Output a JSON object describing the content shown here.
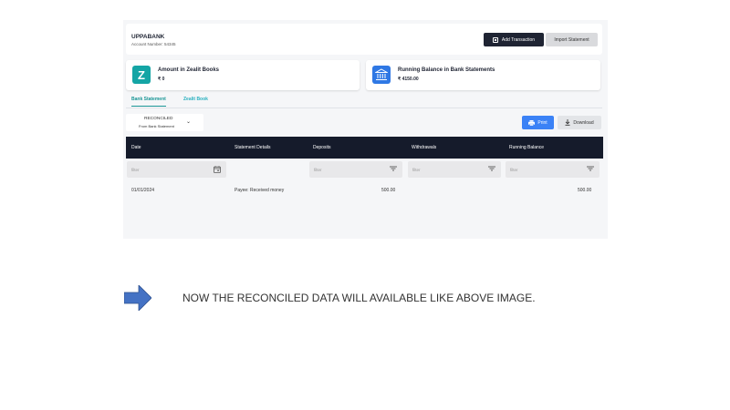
{
  "header": {
    "bank_name": "UPPABANK",
    "account_number": "Account Number: 54345",
    "add_transaction": "Add Transaction",
    "import_statement": "Import Statement"
  },
  "cards": {
    "books_title": "Amount in Zealit Books",
    "books_value": "₹ 0",
    "bank_title": "Running Balance in Bank Statements",
    "bank_value": "₹ 4150.00"
  },
  "tabs": {
    "bank_statement": "Bank Statement",
    "zealit_book": "Zealit Book"
  },
  "filter_dropdown": {
    "selected": "RECONCILED",
    "subtitle": "From Bank Statement"
  },
  "actions": {
    "print": "Print",
    "download": "Download"
  },
  "table": {
    "columns": [
      "Date",
      "Statement Details",
      "Deposits",
      "Withdrawals",
      "Running Balance"
    ],
    "filter_placeholder": "filter",
    "rows": [
      {
        "date": "01/01/2024",
        "details": "Payee: Received money",
        "deposits": "500.00",
        "withdrawals": "",
        "balance": "500.00"
      }
    ]
  },
  "caption": "NOW THE RECONCILED DATA WILL AVAILABLE LIKE ABOVE IMAGE.",
  "colors": {
    "accent_teal": "#1a9696",
    "print_blue": "#3b82f6",
    "header_dark": "#151b2b",
    "arrow_blue": "#4472c4"
  }
}
